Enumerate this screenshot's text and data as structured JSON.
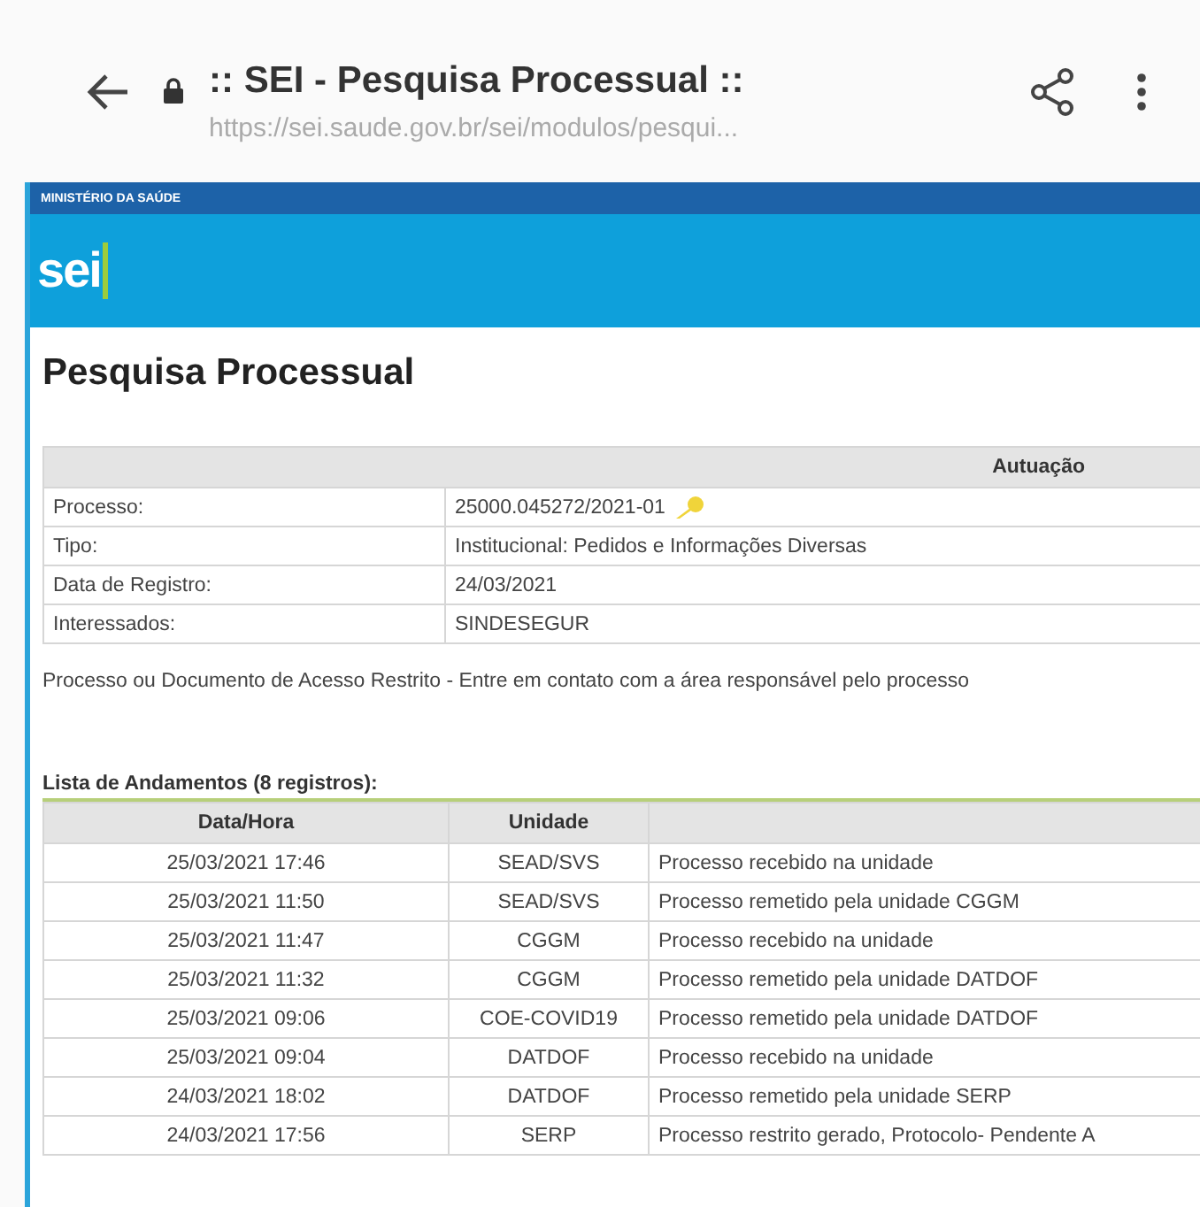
{
  "browser": {
    "title": ":: SEI - Pesquisa Processual ::",
    "url": "https://sei.saude.gov.br/sei/modulos/pesqui..."
  },
  "header": {
    "ministry": "MINISTÉRIO DA SAÚDE",
    "logo": "sei"
  },
  "page_title": "Pesquisa Processual",
  "process_table": {
    "heading": "Autuação",
    "rows": [
      {
        "label": "Processo:",
        "value": "25000.045272/2021-01",
        "kind": "key"
      },
      {
        "label": "Tipo:",
        "value": "Institucional: Pedidos e Informações Diversas",
        "kind": "plain"
      },
      {
        "label": "Data de Registro:",
        "value": "24/03/2021",
        "kind": "plain"
      },
      {
        "label": "Interessados:",
        "value": "SINDESEGUR",
        "kind": "plain"
      }
    ]
  },
  "notice": "Processo ou Documento de Acesso Restrito - Entre em contato com a área responsável pelo processo",
  "history": {
    "caption": "Lista de Andamentos (8 registros):",
    "columns": [
      "Data/Hora",
      "Unidade"
    ],
    "rows": [
      {
        "date": "25/03/2021 17:46",
        "unit": "SEAD/SVS",
        "description": "Processo recebido na unidade"
      },
      {
        "date": "25/03/2021 11:50",
        "unit": "SEAD/SVS",
        "description": "Processo remetido pela unidade CGGM"
      },
      {
        "date": "25/03/2021 11:47",
        "unit": "CGGM",
        "description": "Processo recebido na unidade"
      },
      {
        "date": "25/03/2021 11:32",
        "unit": "CGGM",
        "description": "Processo remetido pela unidade DATDOF"
      },
      {
        "date": "25/03/2021 09:06",
        "unit": "COE-COVID19",
        "description": "Processo remetido pela unidade DATDOF"
      },
      {
        "date": "25/03/2021 09:04",
        "unit": "DATDOF",
        "description": "Processo recebido na unidade"
      },
      {
        "date": "24/03/2021 18:02",
        "unit": "DATDOF",
        "description": "Processo remetido pela unidade SERP"
      },
      {
        "date": "24/03/2021 17:56",
        "unit": "SERP",
        "description": "Processo restrito gerado, Protocolo- Pendente A"
      }
    ]
  }
}
